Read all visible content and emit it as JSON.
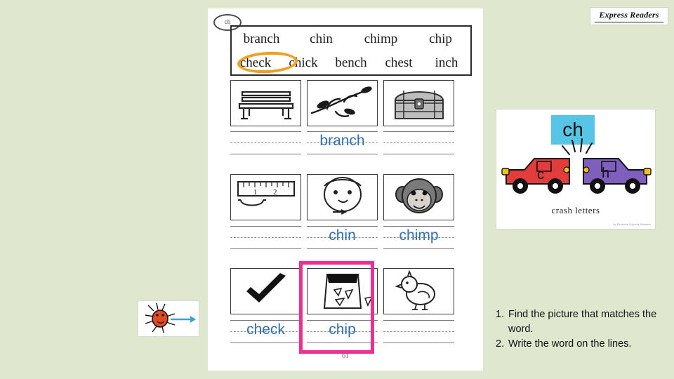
{
  "logo": {
    "text": "Express Readers"
  },
  "worksheet": {
    "tag": "ch",
    "page_number": "61",
    "word_bank": {
      "row1": [
        "branch",
        "chin",
        "chimp",
        "chip"
      ],
      "row2": [
        "check",
        "chick",
        "bench",
        "chest",
        "inch"
      ],
      "circled_word": "check"
    },
    "answers": {
      "row1": [
        "",
        "branch",
        ""
      ],
      "row2": [
        "",
        "chin",
        "chimp"
      ],
      "row3": [
        "check",
        "chip",
        ""
      ]
    },
    "pictures": {
      "row1": [
        "bench",
        "branch",
        "chest"
      ],
      "row2": [
        "inch-ruler",
        "chin",
        "chimp"
      ],
      "row3": [
        "check-mark",
        "chip-bag",
        "chick"
      ]
    }
  },
  "crash_card": {
    "banner_letters": "ch",
    "left_car_letter": "c",
    "right_car_letter": "h",
    "caption": "crash letters",
    "credit": "by Elizabeth\nExpress Readers"
  },
  "instructions": {
    "items": [
      {
        "number": "1.",
        "text": "Find the picture that matches the word."
      },
      {
        "number": "2.",
        "text": "Write the word on the lines."
      }
    ]
  },
  "colors": {
    "background": "#dfe8cf",
    "answer_blue": "#2f6fb3",
    "highlight_magenta": "#ec2f91",
    "circle_orange": "#f0a019",
    "banner_blue": "#57c6e6",
    "car_red": "#e23c3c",
    "car_purple": "#7e5fbd"
  }
}
